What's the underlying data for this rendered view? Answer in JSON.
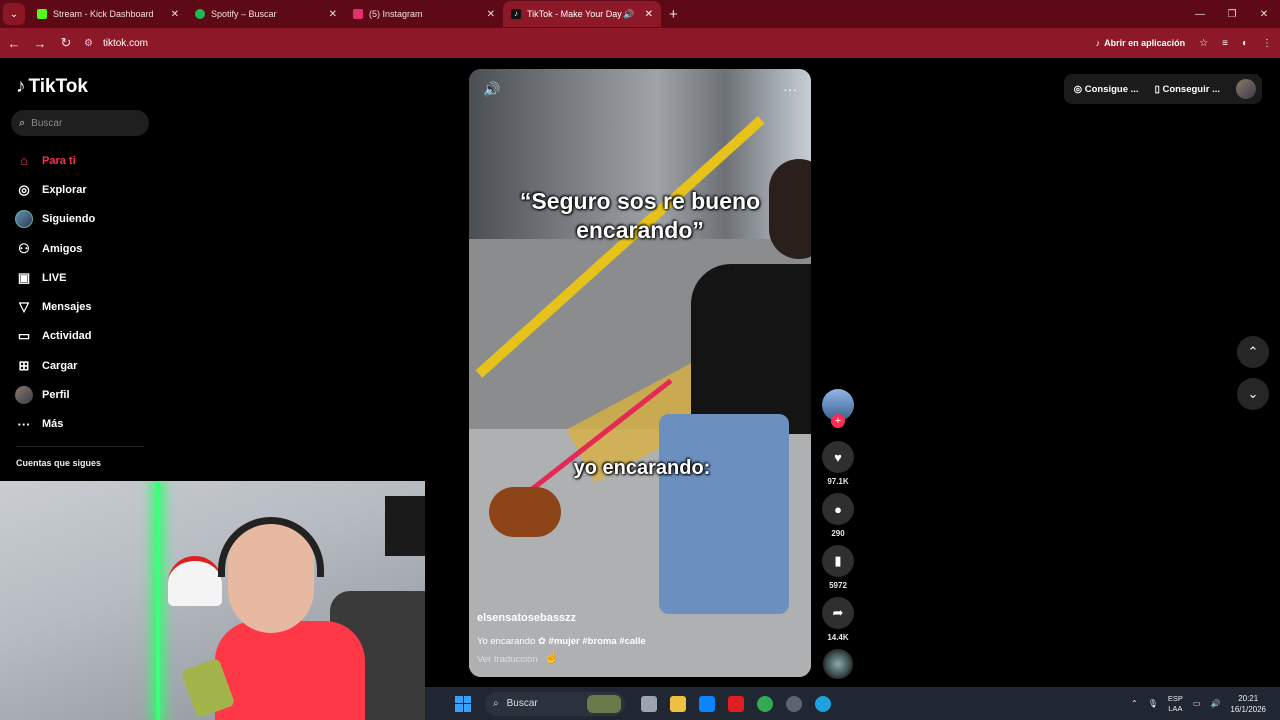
{
  "browser": {
    "tabs": [
      {
        "label": "Stream - Kick Dashboard",
        "favicon_color": "#53fc18",
        "active": false
      },
      {
        "label": "Spotify – Buscar",
        "favicon_color": "#1db954",
        "active": false
      },
      {
        "label": "(5) Instagram",
        "favicon_color": "#e1306c",
        "active": false
      },
      {
        "label": "TikTok - Make Your Day",
        "favicon_color": "#111111",
        "active": true
      }
    ],
    "url": "tiktok.com",
    "open_in_app_label": "Abrir en aplicación"
  },
  "sidebar": {
    "logo": "TikTok",
    "search_placeholder": "Buscar",
    "items": [
      {
        "label": "Para ti",
        "icon": "home-icon",
        "active": true
      },
      {
        "label": "Explorar",
        "icon": "compass-icon",
        "active": false
      },
      {
        "label": "Siguiendo",
        "icon": "avatar-icon",
        "active": false
      },
      {
        "label": "Amigos",
        "icon": "friends-icon",
        "active": false
      },
      {
        "label": "LIVE",
        "icon": "live-icon",
        "active": false
      },
      {
        "label": "Mensajes",
        "icon": "send-icon",
        "active": false
      },
      {
        "label": "Actividad",
        "icon": "message-icon",
        "active": false
      },
      {
        "label": "Cargar",
        "icon": "plus-square-icon",
        "active": false
      },
      {
        "label": "Perfil",
        "icon": "profile-avatar-icon",
        "active": false
      },
      {
        "label": "Más",
        "icon": "more-dots-icon",
        "active": false
      }
    ],
    "following_title": "Cuentas que sigues"
  },
  "video": {
    "caption_top": "“Seguro sos re bueno encarando”",
    "caption_mid": "yo encarando:",
    "username": "elsensatosebasszz",
    "description": "Yo encarando",
    "hashtags": "#mujer #broma #calle",
    "translate_label": "Ver traducción"
  },
  "actions": {
    "likes": "97.1K",
    "comments": "290",
    "saves": "5972",
    "shares": "14.4K"
  },
  "top_right": {
    "coins_label": "Consigue ...",
    "app_label": "Conseguir ..."
  },
  "taskbar": {
    "search_placeholder": "Buscar",
    "lang_line1": "ESP",
    "lang_line2": "LAA",
    "time": "20:21",
    "date": "16/1/2026",
    "app_colors": [
      "#9aa4b0",
      "#f0c040",
      "#0a84ff",
      "#e02020",
      "#34a853",
      "#5a6472",
      "#1fa3e0"
    ]
  }
}
